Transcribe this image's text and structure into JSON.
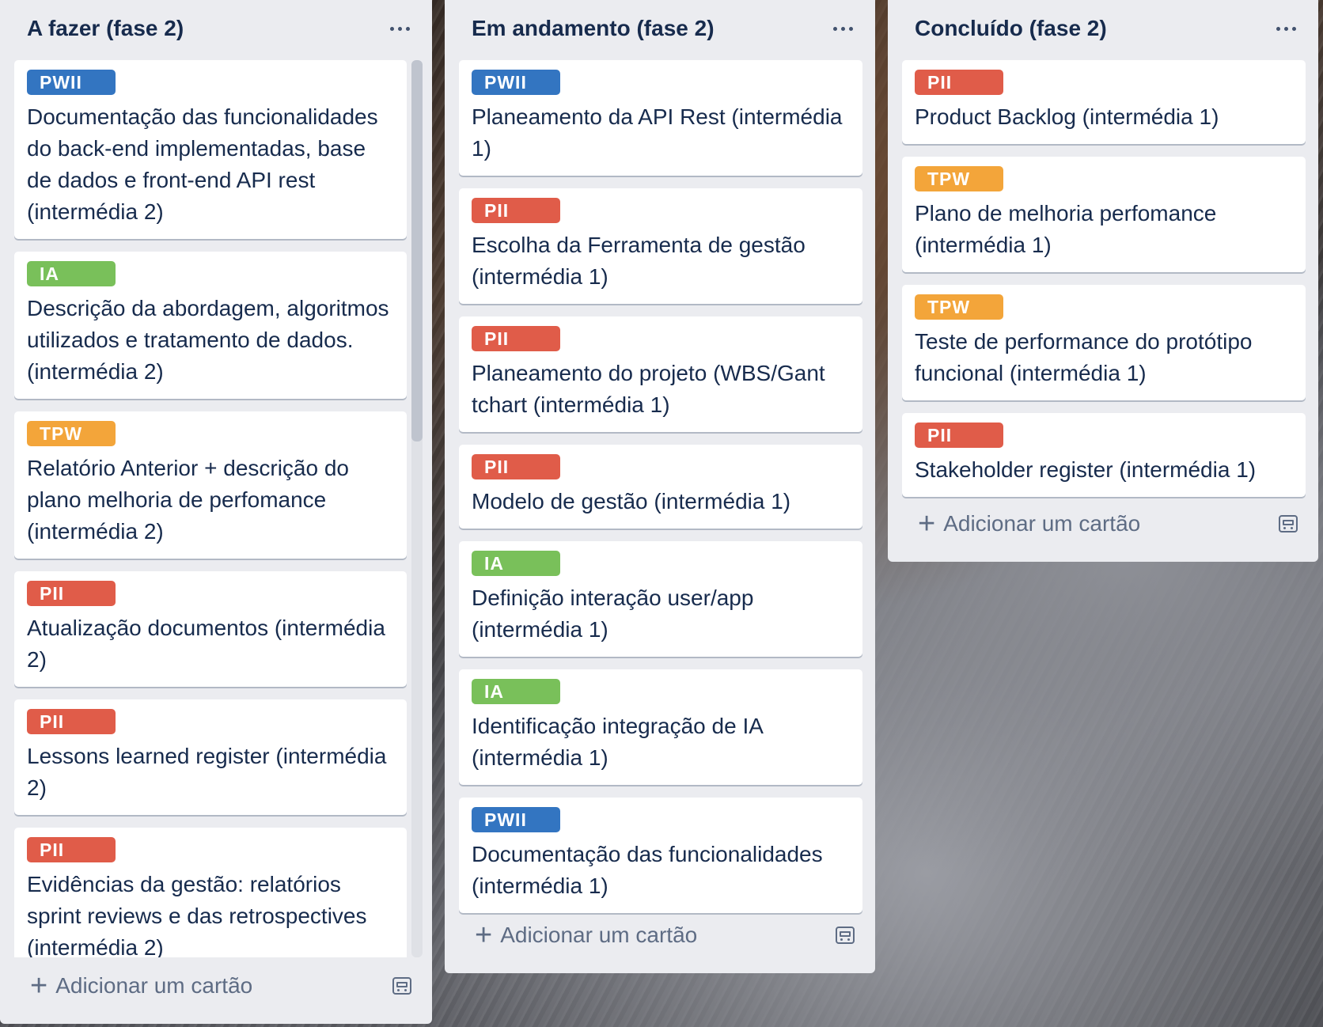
{
  "colors": {
    "PWII": "#3375c1",
    "PII": "#e05c49",
    "IA": "#79c05a",
    "TPW": "#f3a53a"
  },
  "add_card_label": "Adicionar um cartão",
  "lists": [
    {
      "title": "A fazer (fase 2)",
      "cards": [
        {
          "label": "PWII",
          "text": "Documentação das funcionalidades do back-end implementadas, base de dados e front-end API rest (intermédia 2)"
        },
        {
          "label": "IA",
          "text": "Descrição da abordagem, algoritmos utilizados e tratamento de dados. (intermédia 2)"
        },
        {
          "label": "TPW",
          "text": "Relatório Anterior + descrição do plano melhoria de perfomance (intermédia 2)"
        },
        {
          "label": "PII",
          "text": "Atualização documentos (intermédia 2)"
        },
        {
          "label": "PII",
          "text": "Lessons learned register (intermédia 2)"
        },
        {
          "label": "PII",
          "text": "Evidências da gestão: relatórios sprint reviews e das retrospectives (intermédia 2)"
        }
      ]
    },
    {
      "title": "Em andamento (fase 2)",
      "cards": [
        {
          "label": "PWII",
          "text": "Planeamento da API Rest (intermédia 1)"
        },
        {
          "label": "PII",
          "text": "Escolha da Ferramenta de gestão (intermédia 1)"
        },
        {
          "label": "PII",
          "text": "Planeamento do projeto (WBS/Gant tchart (intermédia 1)"
        },
        {
          "label": "PII",
          "text": "Modelo de gestão (intermédia 1)"
        },
        {
          "label": "IA",
          "text": "Definição interação user/app (intermédia 1)"
        },
        {
          "label": "IA",
          "text": "Identificação integração de IA (intermédia 1)"
        },
        {
          "label": "PWII",
          "text": "Documentação das funcionalidades (intermédia 1)"
        }
      ]
    },
    {
      "title": "Concluído (fase 2)",
      "cards": [
        {
          "label": "PII",
          "text": "Product Backlog (intermédia 1)"
        },
        {
          "label": "TPW",
          "text": "Plano de melhoria perfomance (intermédia 1)"
        },
        {
          "label": "TPW",
          "text": "Teste de performance do protótipo funcional (intermédia 1)"
        },
        {
          "label": "PII",
          "text": "Stakeholder register (intermédia 1)"
        }
      ]
    }
  ]
}
